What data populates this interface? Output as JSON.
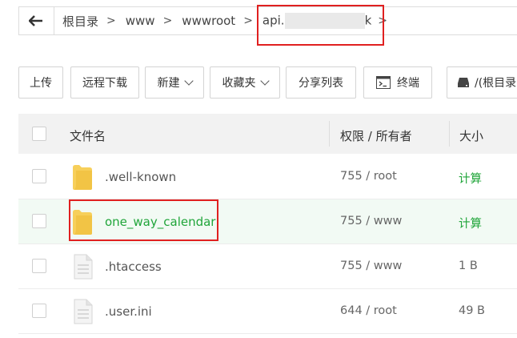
{
  "breadcrumb": {
    "back_label": "←",
    "items": [
      "根目录",
      "www",
      "wwwroot"
    ],
    "last_prefix": "api.",
    "last_suffix": "k"
  },
  "toolbar": {
    "upload": "上传",
    "remote_download": "远程下载",
    "new": "新建",
    "favorites": "收藏夹",
    "share_list": "分享列表",
    "terminal": "终端",
    "disk": "/(根目录"
  },
  "table": {
    "columns": [
      "文件名",
      "权限 / 所有者",
      "大小"
    ],
    "rows": [
      {
        "type": "folder",
        "name": ".well-known",
        "perm": "755 / root",
        "size": "计算"
      },
      {
        "type": "folder",
        "name": "one_way_calendar",
        "perm": "755 / www",
        "size": "计算"
      },
      {
        "type": "file",
        "name": ".htaccess",
        "perm": "755 / www",
        "size": "1 B"
      },
      {
        "type": "file",
        "name": ".user.ini",
        "perm": "644 / root",
        "size": "49 B"
      }
    ]
  },
  "colors": {
    "accent": "#20a53a",
    "highlight_box": "#e02020",
    "folder": "#f7cf5a"
  }
}
